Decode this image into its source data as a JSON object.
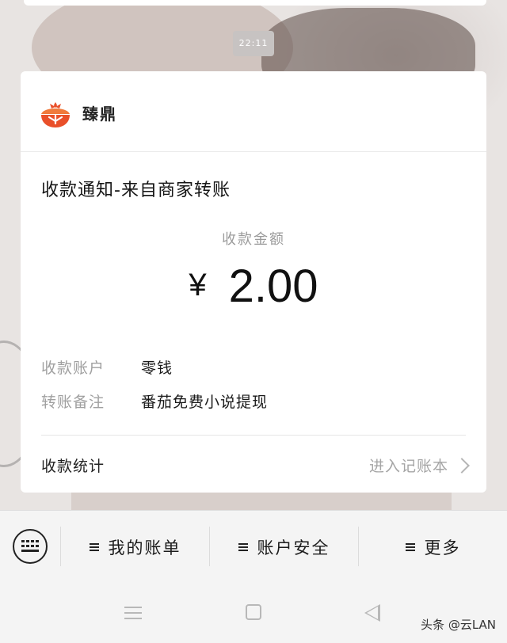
{
  "chat": {
    "time": "22:11"
  },
  "card": {
    "brand": "臻鼎",
    "title": "收款通知-来自商家转账",
    "amount_label": "收款金额",
    "currency_symbol": "¥",
    "amount_value": "2.00",
    "rows": [
      {
        "key": "收款账户",
        "value": "零钱"
      },
      {
        "key": "转账备注",
        "value": "番茄免费小说提现"
      }
    ],
    "footer_left": "收款统计",
    "footer_right": "进入记账本"
  },
  "menu": {
    "items": [
      {
        "label": "我的账单"
      },
      {
        "label": "账户安全"
      },
      {
        "label": "更多"
      }
    ]
  },
  "watermark": "头条 @云LAN",
  "icons": {
    "logo": "tomato-logo-icon",
    "keyboard": "keyboard-icon",
    "menu": "hamburger-icon",
    "chevron": "chevron-right-icon",
    "nav_menu": "nav-menu-icon",
    "nav_home": "nav-home-icon",
    "nav_back": "nav-back-icon"
  },
  "colors": {
    "logo_red": "#e9502a",
    "muted_text": "#a0a0a0"
  }
}
